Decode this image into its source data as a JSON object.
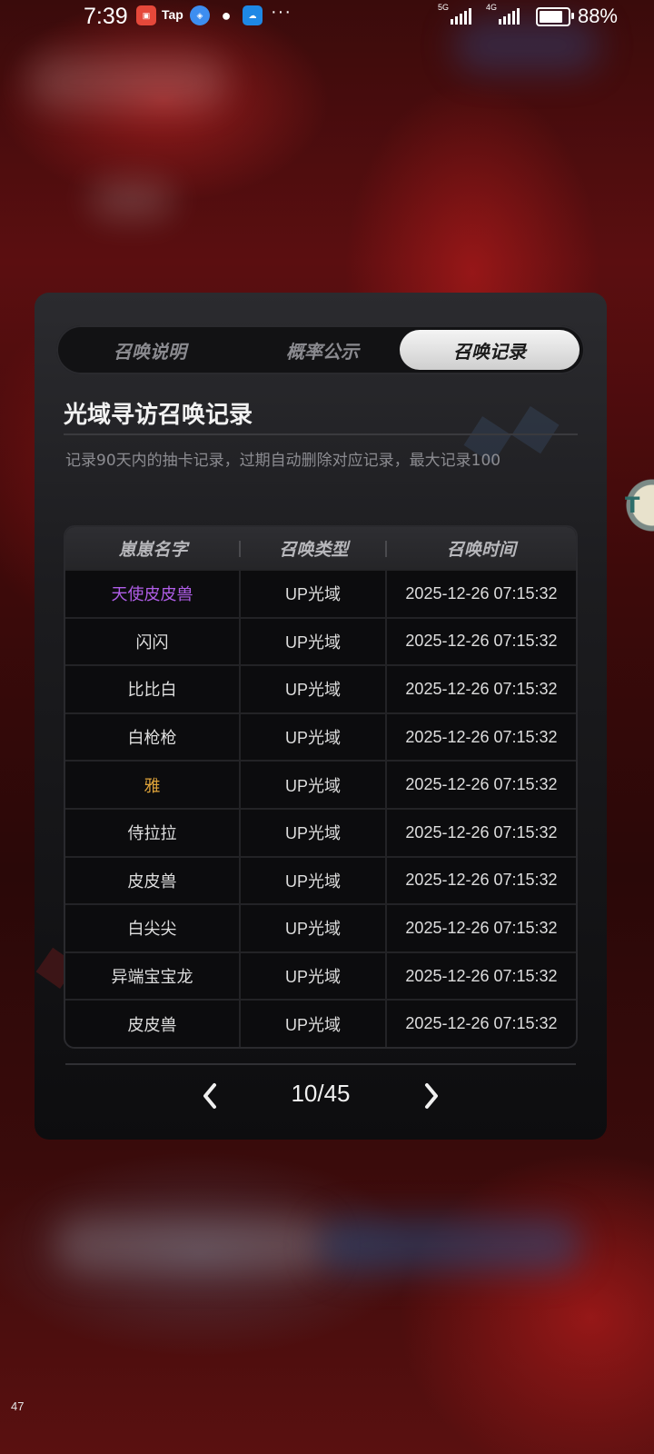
{
  "status_bar": {
    "time": "7:39",
    "app_icons": [
      "huawei-appgallery-icon",
      "tap-icon",
      "browser-icon",
      "wechat-icon",
      "weather-icon"
    ],
    "tap_label": "Tap",
    "more": "···",
    "network_1": "5G",
    "network_2": "4G",
    "battery_percent": "88%",
    "battery_level": 0.88
  },
  "tabs": [
    {
      "label": "召唤说明",
      "active": false
    },
    {
      "label": "概率公示",
      "active": false
    },
    {
      "label": "召唤记录",
      "active": true
    }
  ],
  "record": {
    "title": "光域寻访召唤记录",
    "subtitle": "记录90天内的抽卡记录，过期自动删除对应记录，最大记录100",
    "columns": [
      "崽崽名字",
      "召唤类型",
      "召唤时间"
    ],
    "rows": [
      {
        "name": "天使皮皮兽",
        "type": "UP光域",
        "time": "2025-12-26 07:15:32",
        "rarity": "purple"
      },
      {
        "name": "闪闪",
        "type": "UP光域",
        "time": "2025-12-26 07:15:32",
        "rarity": "normal"
      },
      {
        "name": "比比白",
        "type": "UP光域",
        "time": "2025-12-26 07:15:32",
        "rarity": "normal"
      },
      {
        "name": "白枪枪",
        "type": "UP光域",
        "time": "2025-12-26 07:15:32",
        "rarity": "normal"
      },
      {
        "name": "雅",
        "type": "UP光域",
        "time": "2025-12-26 07:15:32",
        "rarity": "gold"
      },
      {
        "name": "侍拉拉",
        "type": "UP光域",
        "time": "2025-12-26 07:15:32",
        "rarity": "normal"
      },
      {
        "name": "皮皮兽",
        "type": "UP光域",
        "time": "2025-12-26 07:15:32",
        "rarity": "normal"
      },
      {
        "name": "白尖尖",
        "type": "UP光域",
        "time": "2025-12-26 07:15:32",
        "rarity": "normal"
      },
      {
        "name": "异端宝宝龙",
        "type": "UP光域",
        "time": "2025-12-26 07:15:32",
        "rarity": "normal"
      },
      {
        "name": "皮皮兽",
        "type": "UP光域",
        "time": "2025-12-26 07:15:32",
        "rarity": "normal"
      }
    ]
  },
  "pager": {
    "text": "10/45",
    "prev_icon": "chevron-left-icon",
    "next_icon": "chevron-right-icon"
  },
  "side_button_text": "T",
  "corner_number": "47",
  "colors": {
    "purple_rarity": "#b05ee8",
    "gold_rarity": "#e0a43a",
    "active_tab": "#e6e6e6"
  }
}
